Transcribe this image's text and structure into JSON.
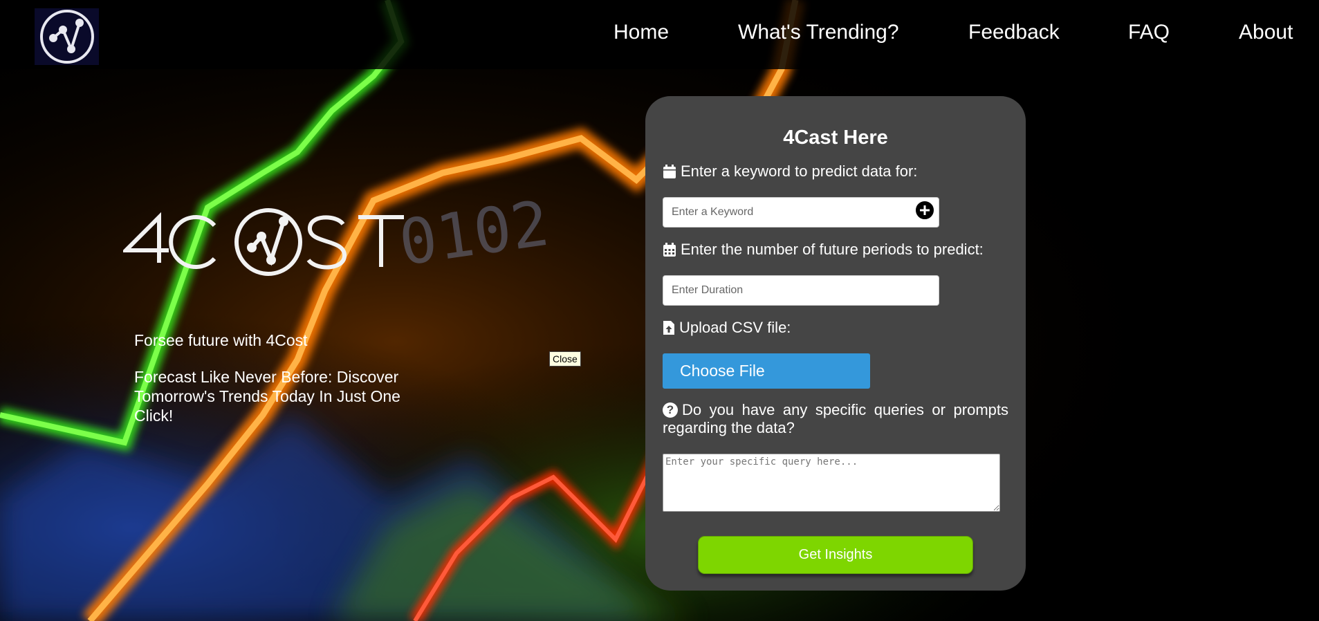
{
  "nav": {
    "items": [
      {
        "label": "Home"
      },
      {
        "label": "What's Trending?"
      },
      {
        "label": "Feedback"
      },
      {
        "label": "FAQ"
      },
      {
        "label": "About"
      }
    ]
  },
  "logo_icon": "network-graph-icon",
  "brand": {
    "wordmark": "4COST"
  },
  "hero": {
    "headline": "Forsee future with 4Cost",
    "subline": "Forecast Like Never Before: Discover Tomorrow's Trends Today In Just One Click!"
  },
  "tooltip": {
    "text": "Close"
  },
  "form": {
    "title": "4Cast Here",
    "keyword_label": "Enter a keyword to predict data for:",
    "keyword_placeholder": "Enter a Keyword",
    "keyword_add_icon": "plus-circle-icon",
    "duration_label": "Enter the number of future periods to predict:",
    "duration_placeholder": "Enter Duration",
    "upload_label": "Upload CSV file:",
    "choose_file_label": "Choose File",
    "query_icon_text": "?",
    "query_label": "Do you have any specific queries or prompts regarding the data?",
    "query_placeholder": "Enter your specific query here...",
    "submit_label": "Get Insights"
  },
  "background_numbers": [
    "0102"
  ],
  "colors": {
    "panel": "#454545",
    "cta": "#7ED600",
    "file_button": "#3498DB",
    "navbar": "#000000"
  }
}
